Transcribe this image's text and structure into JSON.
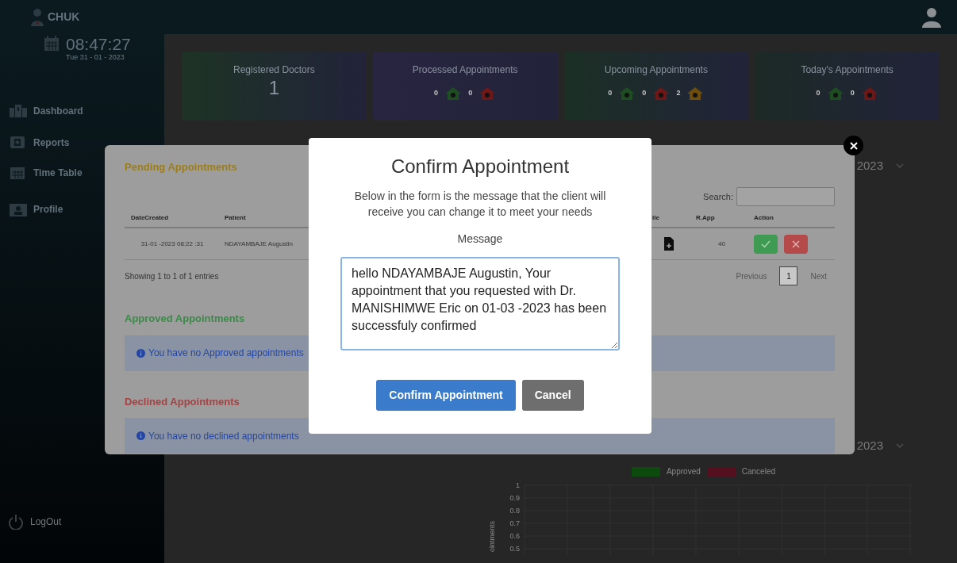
{
  "topbar": {
    "brand": "CHUK"
  },
  "sidebar": {
    "clock": {
      "time": "08:47:27",
      "date": "Tue 31 - 01 - 2023"
    },
    "items": [
      {
        "label": "Dashboard"
      },
      {
        "label": "Reports"
      },
      {
        "label": "Time Table"
      },
      {
        "label": "Profile"
      }
    ],
    "logout": "LogOut"
  },
  "stat_cards": [
    {
      "title": "Registered Doctors",
      "color": "#1d3324",
      "value": "1"
    },
    {
      "title": "Processed Appointments",
      "color": "#282540",
      "counts": [
        {
          "value": "0",
          "color": "#1f4d22"
        },
        {
          "value": "0",
          "color": "#6e1717"
        }
      ]
    },
    {
      "title": "Upcoming Appointments",
      "color": "#1b2f24",
      "counts": [
        {
          "value": "0",
          "color": "#1f4d22"
        },
        {
          "value": "0",
          "color": "#6e1717"
        },
        {
          "value": "2",
          "color": "#6e4c0b"
        }
      ]
    },
    {
      "title": "Today's Appointments",
      "color": "#1c2a26",
      "counts": [
        {
          "value": "0",
          "color": "#1f4d22"
        },
        {
          "value": "0",
          "color": "#6e1717"
        }
      ]
    }
  ],
  "year_filters": [
    "2023",
    "2023"
  ],
  "chart": {
    "legend": [
      {
        "label": "Approved",
        "color": "#0d4a0d"
      },
      {
        "label": "Canceled",
        "color": "#55101f"
      }
    ],
    "y_ticks": [
      "1",
      "0.9",
      "0.8",
      "0.7",
      "0.6",
      "0.5"
    ],
    "y_label": "ointments"
  },
  "appointments_modal": {
    "pending": {
      "title": "Pending Appointments",
      "search_label": "Search:",
      "columns": [
        "DateCreated",
        "Patient",
        "ile",
        "R.App",
        "Action"
      ],
      "rows": [
        {
          "date_created": "31-01 -2023 08:22 :31",
          "patient": "NDAYAMBAJE Augustin",
          "r_app": "40"
        }
      ],
      "info": "Showing 1 to 1 of 1 entries",
      "pagination": {
        "previous": "Previous",
        "pages": [
          {
            "label": "1",
            "selected": true
          }
        ],
        "next": "Next"
      }
    },
    "approved": {
      "title": "Approved Appointments",
      "message": "You have no Approved appointments"
    },
    "declined": {
      "title": "Declined Appointments",
      "message": "You have no declined appointments"
    }
  },
  "confirm_dialog": {
    "title": "Confirm Appointment",
    "description": "Below in the form is the message that the client will receive you can change it to meet your needs",
    "field_label": "Message",
    "message": "hello NDAYAMBAJE Augustin, Your appointment that you requested with Dr. MANISHIMWE Eric on 01-03 -2023 has been successfuly confirmed",
    "buttons": [
      {
        "label": "Confirm Appointment",
        "kind": "primary"
      },
      {
        "label": "Cancel",
        "kind": "secondary"
      }
    ]
  }
}
